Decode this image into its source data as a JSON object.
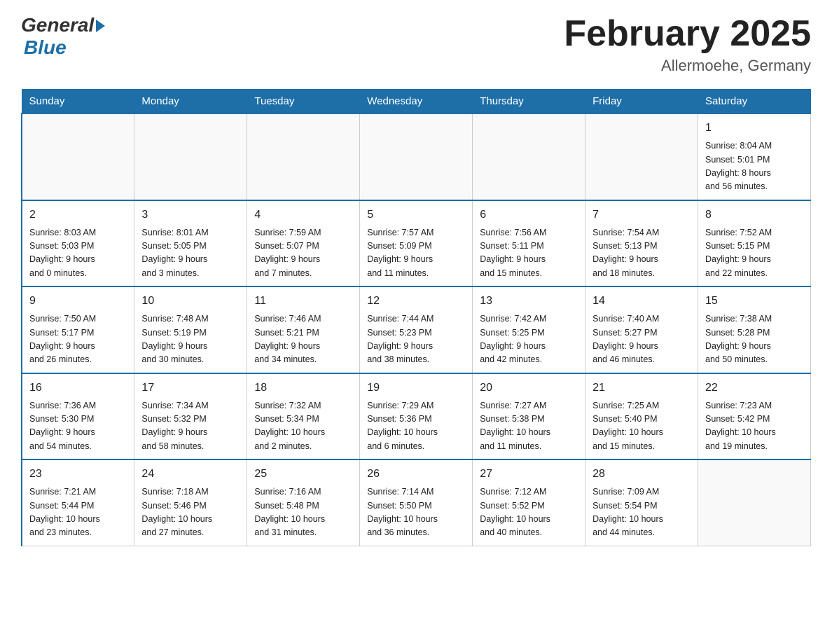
{
  "header": {
    "title": "February 2025",
    "location": "Allermoehe, Germany"
  },
  "logo": {
    "part1": "General",
    "part2": "Blue"
  },
  "days_of_week": [
    "Sunday",
    "Monday",
    "Tuesday",
    "Wednesday",
    "Thursday",
    "Friday",
    "Saturday"
  ],
  "weeks": [
    [
      {
        "day": "",
        "info": ""
      },
      {
        "day": "",
        "info": ""
      },
      {
        "day": "",
        "info": ""
      },
      {
        "day": "",
        "info": ""
      },
      {
        "day": "",
        "info": ""
      },
      {
        "day": "",
        "info": ""
      },
      {
        "day": "1",
        "info": "Sunrise: 8:04 AM\nSunset: 5:01 PM\nDaylight: 8 hours\nand 56 minutes."
      }
    ],
    [
      {
        "day": "2",
        "info": "Sunrise: 8:03 AM\nSunset: 5:03 PM\nDaylight: 9 hours\nand 0 minutes."
      },
      {
        "day": "3",
        "info": "Sunrise: 8:01 AM\nSunset: 5:05 PM\nDaylight: 9 hours\nand 3 minutes."
      },
      {
        "day": "4",
        "info": "Sunrise: 7:59 AM\nSunset: 5:07 PM\nDaylight: 9 hours\nand 7 minutes."
      },
      {
        "day": "5",
        "info": "Sunrise: 7:57 AM\nSunset: 5:09 PM\nDaylight: 9 hours\nand 11 minutes."
      },
      {
        "day": "6",
        "info": "Sunrise: 7:56 AM\nSunset: 5:11 PM\nDaylight: 9 hours\nand 15 minutes."
      },
      {
        "day": "7",
        "info": "Sunrise: 7:54 AM\nSunset: 5:13 PM\nDaylight: 9 hours\nand 18 minutes."
      },
      {
        "day": "8",
        "info": "Sunrise: 7:52 AM\nSunset: 5:15 PM\nDaylight: 9 hours\nand 22 minutes."
      }
    ],
    [
      {
        "day": "9",
        "info": "Sunrise: 7:50 AM\nSunset: 5:17 PM\nDaylight: 9 hours\nand 26 minutes."
      },
      {
        "day": "10",
        "info": "Sunrise: 7:48 AM\nSunset: 5:19 PM\nDaylight: 9 hours\nand 30 minutes."
      },
      {
        "day": "11",
        "info": "Sunrise: 7:46 AM\nSunset: 5:21 PM\nDaylight: 9 hours\nand 34 minutes."
      },
      {
        "day": "12",
        "info": "Sunrise: 7:44 AM\nSunset: 5:23 PM\nDaylight: 9 hours\nand 38 minutes."
      },
      {
        "day": "13",
        "info": "Sunrise: 7:42 AM\nSunset: 5:25 PM\nDaylight: 9 hours\nand 42 minutes."
      },
      {
        "day": "14",
        "info": "Sunrise: 7:40 AM\nSunset: 5:27 PM\nDaylight: 9 hours\nand 46 minutes."
      },
      {
        "day": "15",
        "info": "Sunrise: 7:38 AM\nSunset: 5:28 PM\nDaylight: 9 hours\nand 50 minutes."
      }
    ],
    [
      {
        "day": "16",
        "info": "Sunrise: 7:36 AM\nSunset: 5:30 PM\nDaylight: 9 hours\nand 54 minutes."
      },
      {
        "day": "17",
        "info": "Sunrise: 7:34 AM\nSunset: 5:32 PM\nDaylight: 9 hours\nand 58 minutes."
      },
      {
        "day": "18",
        "info": "Sunrise: 7:32 AM\nSunset: 5:34 PM\nDaylight: 10 hours\nand 2 minutes."
      },
      {
        "day": "19",
        "info": "Sunrise: 7:29 AM\nSunset: 5:36 PM\nDaylight: 10 hours\nand 6 minutes."
      },
      {
        "day": "20",
        "info": "Sunrise: 7:27 AM\nSunset: 5:38 PM\nDaylight: 10 hours\nand 11 minutes."
      },
      {
        "day": "21",
        "info": "Sunrise: 7:25 AM\nSunset: 5:40 PM\nDaylight: 10 hours\nand 15 minutes."
      },
      {
        "day": "22",
        "info": "Sunrise: 7:23 AM\nSunset: 5:42 PM\nDaylight: 10 hours\nand 19 minutes."
      }
    ],
    [
      {
        "day": "23",
        "info": "Sunrise: 7:21 AM\nSunset: 5:44 PM\nDaylight: 10 hours\nand 23 minutes."
      },
      {
        "day": "24",
        "info": "Sunrise: 7:18 AM\nSunset: 5:46 PM\nDaylight: 10 hours\nand 27 minutes."
      },
      {
        "day": "25",
        "info": "Sunrise: 7:16 AM\nSunset: 5:48 PM\nDaylight: 10 hours\nand 31 minutes."
      },
      {
        "day": "26",
        "info": "Sunrise: 7:14 AM\nSunset: 5:50 PM\nDaylight: 10 hours\nand 36 minutes."
      },
      {
        "day": "27",
        "info": "Sunrise: 7:12 AM\nSunset: 5:52 PM\nDaylight: 10 hours\nand 40 minutes."
      },
      {
        "day": "28",
        "info": "Sunrise: 7:09 AM\nSunset: 5:54 PM\nDaylight: 10 hours\nand 44 minutes."
      },
      {
        "day": "",
        "info": ""
      }
    ]
  ]
}
